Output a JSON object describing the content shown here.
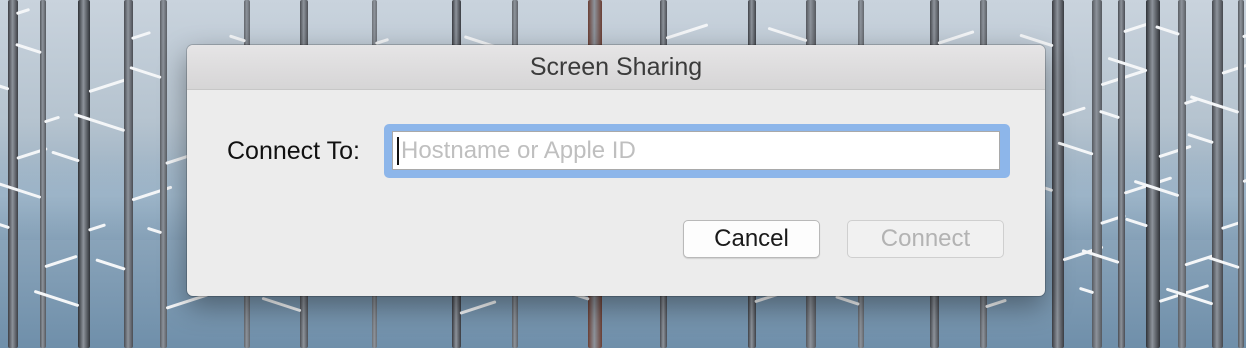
{
  "dialog": {
    "title": "Screen Sharing",
    "connect_label": "Connect To:",
    "host_field": {
      "placeholder": "Hostname or Apple ID",
      "value": ""
    },
    "cancel_label": "Cancel",
    "connect_button_label": "Connect"
  },
  "colors": {
    "focus_ring": "#8db6ea",
    "dialog_background": "#ececec",
    "disabled_text": "#b3b3b3"
  },
  "icons": [
    "text-caret"
  ]
}
